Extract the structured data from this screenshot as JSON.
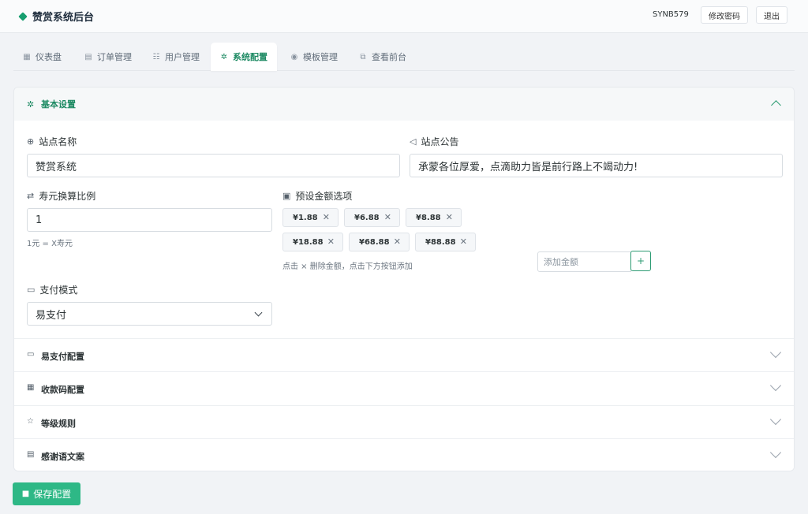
{
  "header": {
    "title": "赞赏系统后台",
    "user_id": "SYNB579",
    "change_password": "修改密码",
    "logout": "退出"
  },
  "tabs": [
    {
      "label": "仪表盘",
      "icon": "dashboard-icon"
    },
    {
      "label": "订单管理",
      "icon": "orders-icon"
    },
    {
      "label": "用户管理",
      "icon": "users-icon"
    },
    {
      "label": "系统配置",
      "icon": "gear-icon",
      "active": true
    },
    {
      "label": "模板管理",
      "icon": "palette-icon"
    },
    {
      "label": "查看前台",
      "icon": "external-link-icon"
    }
  ],
  "basic": {
    "title": "基本设置",
    "site_name_label": "站点名称",
    "site_name_value": "赞赏系统",
    "notice_label": "站点公告",
    "notice_value": "承蒙各位厚爱，点滴助力皆是前行路上不竭动力!",
    "ratio_label": "寿元换算比例",
    "ratio_value": "1",
    "ratio_hint": "1元 = X寿元",
    "amounts_label": "预设金额选项",
    "amounts": [
      "¥1.88",
      "¥6.88",
      "¥8.88",
      "¥18.88",
      "¥68.88",
      "¥88.88"
    ],
    "amounts_hint": "点击 × 删除金额，点击下方按钮添加",
    "add_amount_placeholder": "添加金额",
    "add_button": "+",
    "pay_mode_label": "支付模式",
    "pay_mode_value": "易支付"
  },
  "sections": [
    {
      "title": "易支付配置",
      "icon": "card-icon"
    },
    {
      "title": "收款码配置",
      "icon": "qrcode-icon"
    },
    {
      "title": "等级规则",
      "icon": "star-icon"
    },
    {
      "title": "感谢语文案",
      "icon": "message-icon"
    }
  ],
  "save_button": "保存配置",
  "colors": {
    "accent": "#1d8a63",
    "save": "#2eb886"
  }
}
